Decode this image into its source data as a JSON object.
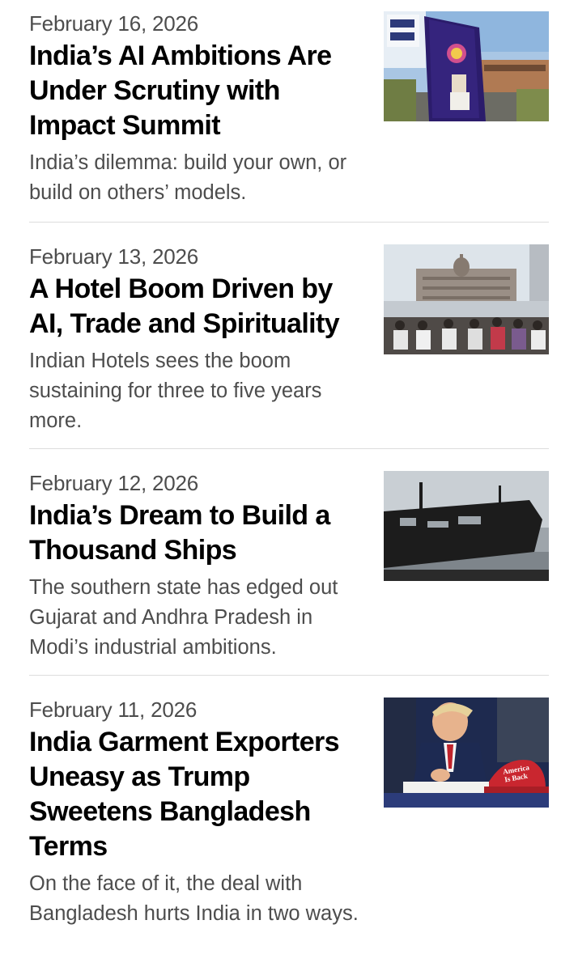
{
  "articles": [
    {
      "date": "February 16, 2026",
      "headline": "India’s AI Ambitions Are Under Scrutiny with Impact Summit",
      "dek": "India’s dilemma: build your own, or build on others’ models.",
      "thumbnail": "ai-summit-billboard-photo"
    },
    {
      "date": "February 13, 2026",
      "headline": "A Hotel Boom Driven by AI, Trade and Spirituality",
      "dek": "Indian Hotels sees the boom sustaining for three to five years more.",
      "thumbnail": "taj-hotel-waterfront-photo"
    },
    {
      "date": "February 12, 2026",
      "headline": "India’s Dream to Build a Thousand Ships",
      "dek": "The southern state has edged out Gujarat and Andhra Pradesh in Modi’s industrial ambitions.",
      "thumbnail": "cargo-ship-photo"
    },
    {
      "date": "February 11, 2026",
      "headline": "India Garment Exporters Uneasy as Trump Sweetens Bangladesh Terms",
      "dek": "On the face of it, the deal with Bangladesh hurts India in two ways.",
      "thumbnail": "trump-signing-photo",
      "thumbnail_text": [
        "America",
        "Is Back"
      ]
    }
  ]
}
